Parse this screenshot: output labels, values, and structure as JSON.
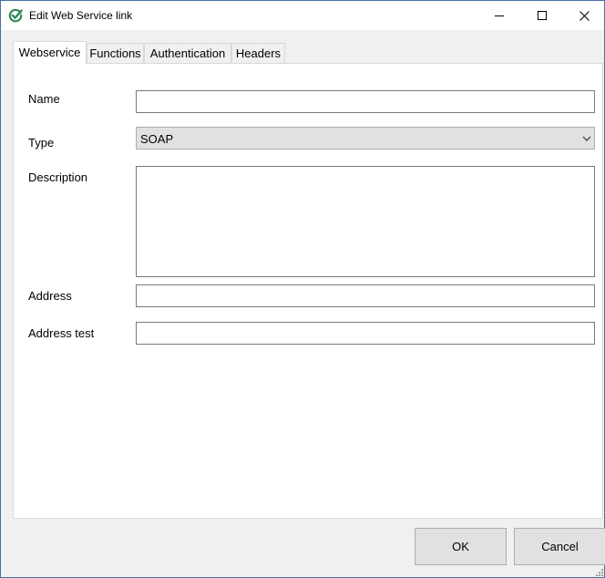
{
  "window": {
    "title": "Edit Web Service link",
    "icon": "check-circle-icon",
    "accent_color": "#2e8b57",
    "controls": [
      "minimize-icon",
      "maximize-icon",
      "close-icon"
    ]
  },
  "tabs": [
    {
      "label": "Webservice",
      "active": true
    },
    {
      "label": "Functions",
      "active": false
    },
    {
      "label": "Authentication",
      "active": false
    },
    {
      "label": "Headers",
      "active": false
    }
  ],
  "form": {
    "name": {
      "label": "Name",
      "value": ""
    },
    "type": {
      "label": "Type",
      "value": "SOAP"
    },
    "description": {
      "label": "Description",
      "value": ""
    },
    "address": {
      "label": "Address",
      "value": ""
    },
    "address_test": {
      "label": "Address test",
      "value": ""
    }
  },
  "buttons": {
    "ok": "OK",
    "cancel": "Cancel"
  }
}
